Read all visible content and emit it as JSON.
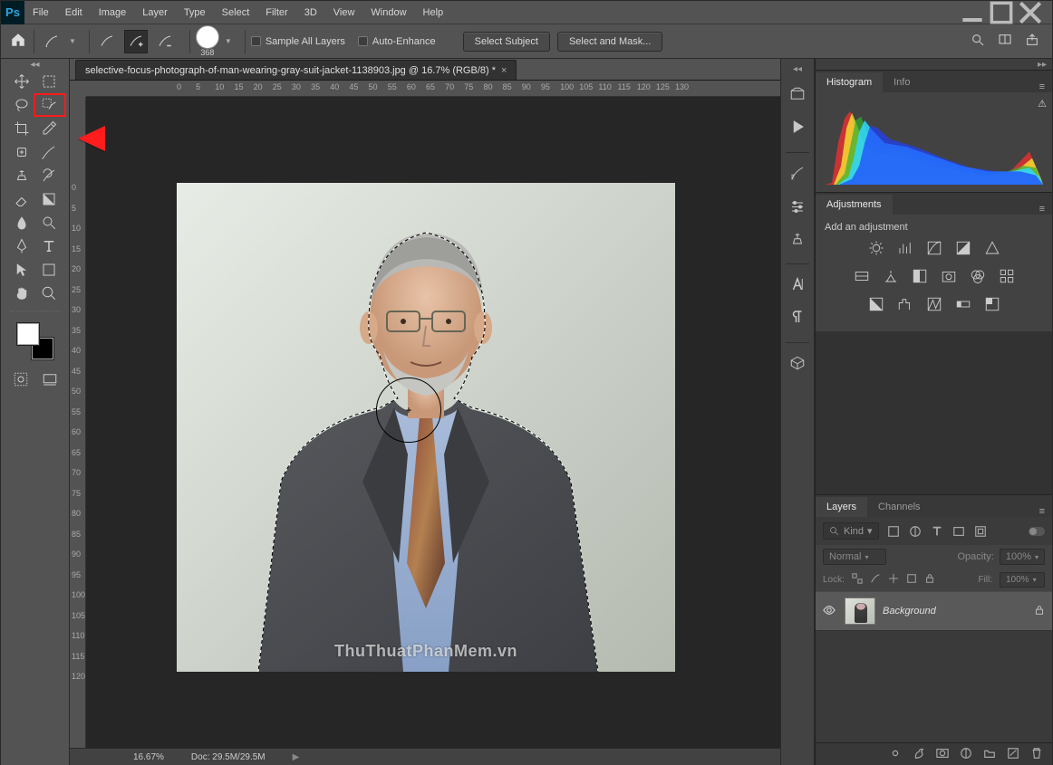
{
  "menubar": {
    "items": [
      "File",
      "Edit",
      "Image",
      "Layer",
      "Type",
      "Select",
      "Filter",
      "3D",
      "View",
      "Window",
      "Help"
    ]
  },
  "options": {
    "brush_size": "368",
    "sample_all_label": "Sample All Layers",
    "auto_enhance_label": "Auto-Enhance",
    "select_subject_label": "Select Subject",
    "select_mask_label": "Select and Mask..."
  },
  "document": {
    "tab_title": "selective-focus-photograph-of-man-wearing-gray-suit-jacket-1138903.jpg @ 16.7% (RGB/8) *",
    "watermark": "ThuThuatPhanMem.vn",
    "ruler_h": [
      "0",
      "5",
      "10",
      "15",
      "20",
      "25",
      "30",
      "35",
      "40",
      "45",
      "50",
      "55",
      "60",
      "65",
      "70",
      "75",
      "80",
      "85",
      "90",
      "95",
      "100",
      "105",
      "110",
      "115",
      "120",
      "125",
      "130"
    ],
    "ruler_v": [
      "0",
      "5",
      "10",
      "15",
      "20",
      "25",
      "30",
      "35",
      "40",
      "45",
      "50",
      "55",
      "60",
      "65",
      "70",
      "75",
      "80",
      "85",
      "90",
      "95",
      "100",
      "105",
      "110",
      "115",
      "120"
    ]
  },
  "status": {
    "zoom": "16.67%",
    "doc_size": "Doc: 29.5M/29.5M"
  },
  "panels": {
    "histogram_tab": "Histogram",
    "info_tab": "Info",
    "adjustments_tab": "Adjustments",
    "adjustments_hint": "Add an adjustment",
    "layers_tab": "Layers",
    "channels_tab": "Channels",
    "kind_label": "Kind",
    "blend_mode": "Normal",
    "opacity_label": "Opacity:",
    "opacity_value": "100%",
    "lock_label": "Lock:",
    "fill_label": "Fill:",
    "fill_value": "100%",
    "layer0_name": "Background"
  }
}
